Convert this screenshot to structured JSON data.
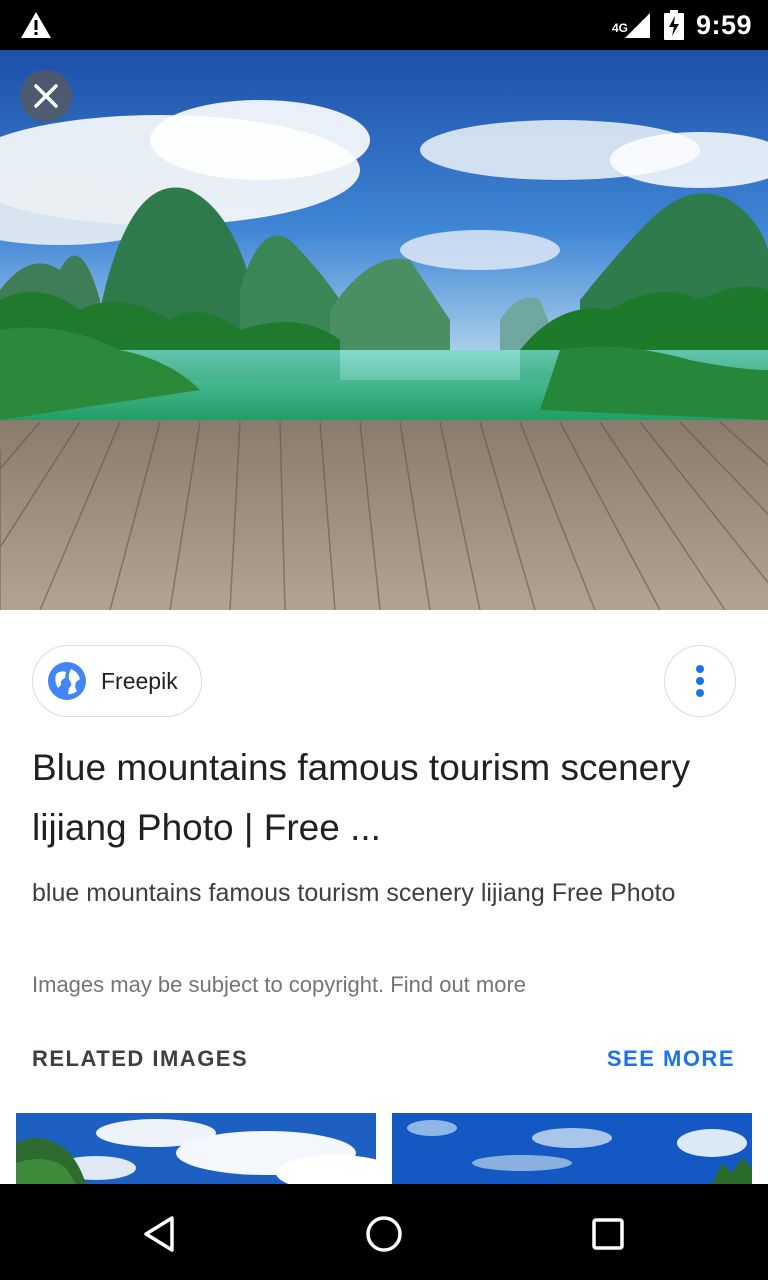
{
  "status_bar": {
    "time": "9:59",
    "network_type": "4G",
    "icons": [
      "warning-icon",
      "signal-icon",
      "battery-charging-icon"
    ]
  },
  "hero": {
    "close_icon": "close-icon",
    "colors": {
      "sky": "#2f6fc0",
      "water": "#2aa66a",
      "deck": "#9b8b78"
    }
  },
  "source": {
    "label": "Freepik",
    "icon": "globe-icon",
    "more_icon": "more-vert-icon"
  },
  "result": {
    "title": "Blue mountains famous tourism scenery lijiang Photo | Free ...",
    "description": "blue mountains famous tourism scenery lijiang Free Photo",
    "copyright_text": "Images may be subject to copyright.",
    "copyright_link": "Find out more"
  },
  "related": {
    "heading": "RELATED IMAGES",
    "see_more": "SEE MORE",
    "accent_color": "#1a73e8"
  },
  "nav_bar": {
    "icons": [
      "back-icon",
      "home-icon",
      "recents-icon"
    ]
  }
}
